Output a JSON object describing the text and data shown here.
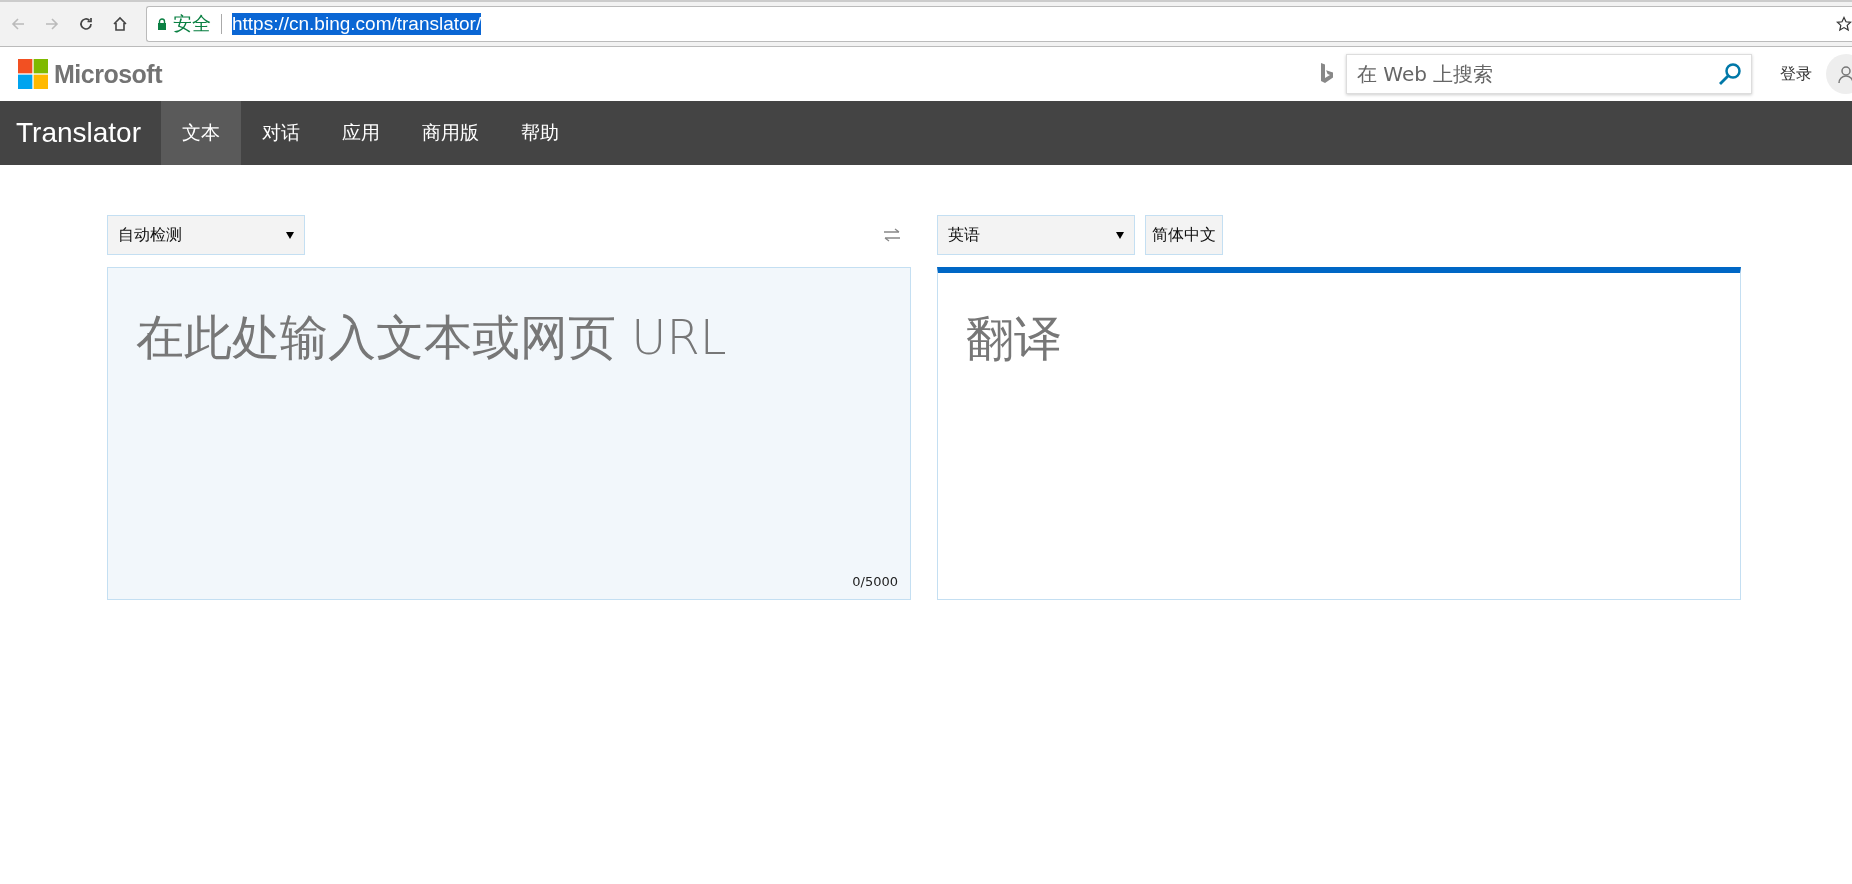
{
  "browser": {
    "security_label": "安全",
    "url": "https://cn.bing.com/translator/",
    "url_selected": true
  },
  "header": {
    "logo": "Microsoft",
    "search": {
      "placeholder": "在 Web 上搜索"
    },
    "sign_in": "登录"
  },
  "nav": {
    "brand": "Translator",
    "tabs": [
      {
        "label": "文本",
        "selected": true
      },
      {
        "label": "对话",
        "selected": false
      },
      {
        "label": "应用",
        "selected": false
      },
      {
        "label": "商用版",
        "selected": false
      },
      {
        "label": "帮助",
        "selected": false
      }
    ]
  },
  "source": {
    "language": "自动检测",
    "placeholder": "在此处输入文本或网页 URL",
    "counter": "0/5000"
  },
  "target": {
    "language": "英语",
    "quick_language": "简体中文",
    "placeholder": "翻译"
  }
}
